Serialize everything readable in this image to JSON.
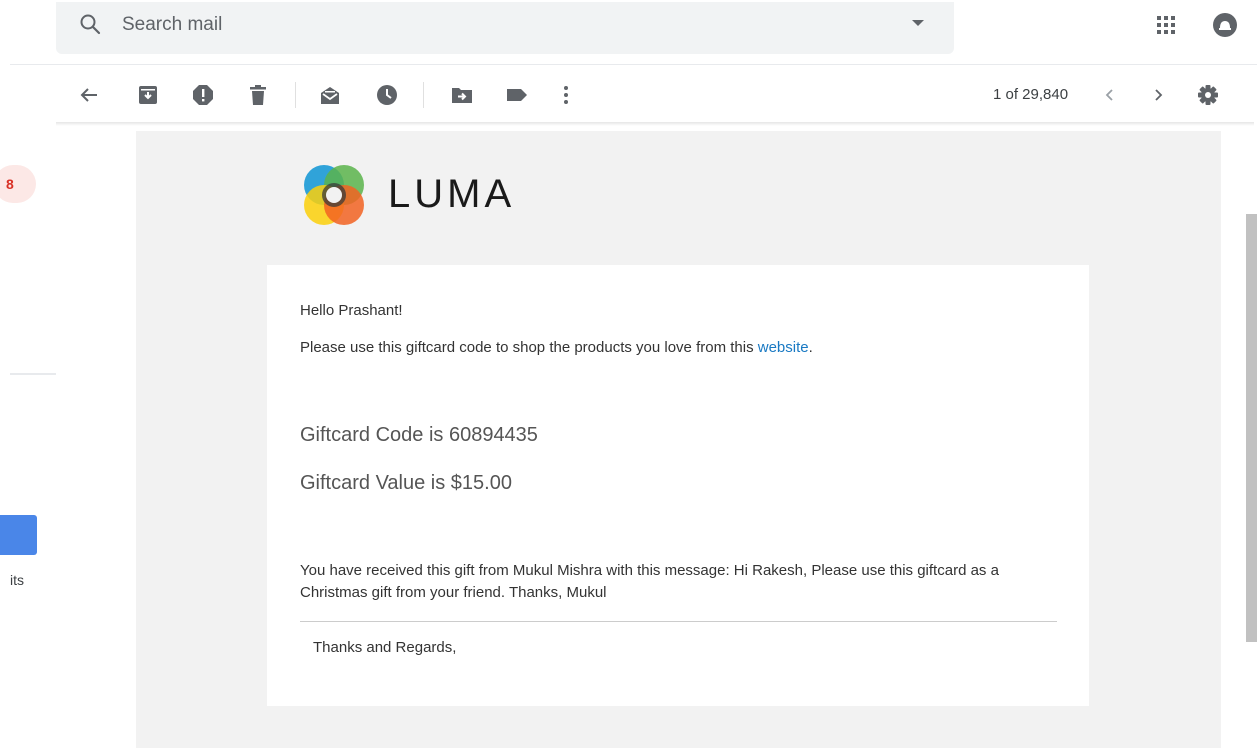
{
  "search": {
    "placeholder": "Search mail"
  },
  "header": {
    "icons": [
      "search-icon",
      "dropdown-caret-icon",
      "apps-grid-icon",
      "account-icon"
    ]
  },
  "toolbar": {
    "icons": [
      "back-arrow-icon",
      "archive-icon",
      "report-spam-icon",
      "delete-icon",
      "mark-unread-icon",
      "snooze-icon",
      "move-to-icon",
      "label-icon",
      "more-vertical-icon",
      "chevron-left-icon",
      "chevron-right-icon",
      "settings-icon"
    ],
    "pager": "1 of 29,840"
  },
  "sidebar": {
    "badge_text": "8",
    "partial_label": "its"
  },
  "email": {
    "brand": "LUMA",
    "greeting": "Hello Prashant!",
    "intro_text": "Please use this giftcard code to shop the products you love from this ",
    "intro_link": "website",
    "intro_end": ".",
    "code_line": "Giftcard Code is 60894435",
    "value_line": "Giftcard Value is $15.00",
    "message": "You have received this gift from Mukul Mishra with this message: Hi Rakesh, Please use this giftcard as a Christmas gift from your friend. Thanks, Mukul",
    "signoff": "Thanks and Regards,"
  },
  "colors": {
    "link": "#1979c3",
    "badge": "#d93025",
    "logo_blue": "#1b9ad6",
    "logo_green": "#5ab44b",
    "logo_orange": "#f26322",
    "logo_yellow": "#fcd00a"
  }
}
